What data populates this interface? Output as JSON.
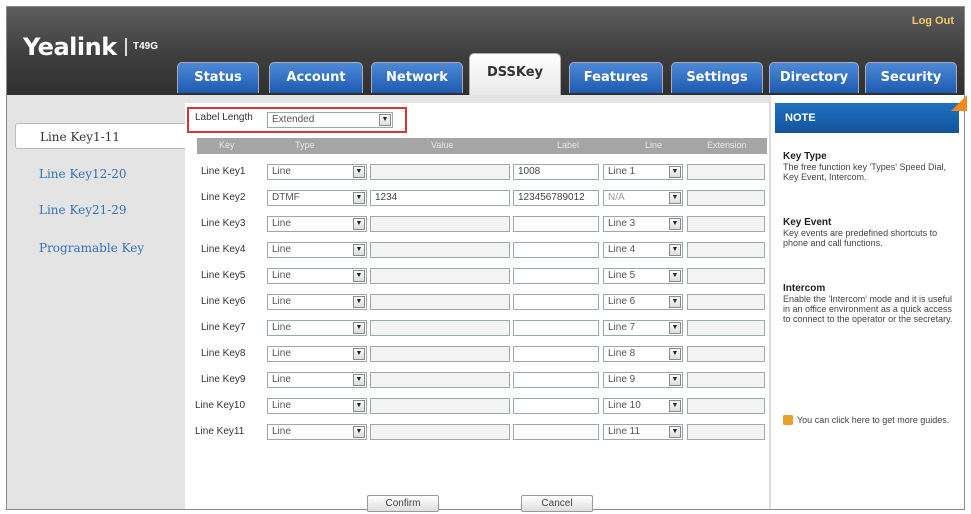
{
  "header": {
    "logo": "Yealink",
    "model": "T49G",
    "logout": "Log Out"
  },
  "tabs": [
    {
      "label": "Status"
    },
    {
      "label": "Account"
    },
    {
      "label": "Network"
    },
    {
      "label": "DSSKey"
    },
    {
      "label": "Features"
    },
    {
      "label": "Settings"
    },
    {
      "label": "Directory"
    },
    {
      "label": "Security"
    }
  ],
  "sidebar": {
    "items": [
      "Line Key1-11",
      "Line Key12-20",
      "Line Key21-29",
      "Programable Key"
    ]
  },
  "label_length": {
    "label": "Label Length",
    "value": "Extended"
  },
  "table": {
    "headers": [
      "Key",
      "Type",
      "Value",
      "Label",
      "Line",
      "Extension"
    ],
    "rows": [
      {
        "key": "Line Key1",
        "type": "Line",
        "value": "",
        "label": "1008",
        "line": "Line 1"
      },
      {
        "key": "Line Key2",
        "type": "DTMF",
        "value": "1234",
        "label": "123456789012",
        "line": "N/A"
      },
      {
        "key": "Line Key3",
        "type": "Line",
        "value": "",
        "label": "",
        "line": "Line 3"
      },
      {
        "key": "Line Key4",
        "type": "Line",
        "value": "",
        "label": "",
        "line": "Line 4"
      },
      {
        "key": "Line Key5",
        "type": "Line",
        "value": "",
        "label": "",
        "line": "Line 5"
      },
      {
        "key": "Line Key6",
        "type": "Line",
        "value": "",
        "label": "",
        "line": "Line 6"
      },
      {
        "key": "Line Key7",
        "type": "Line",
        "value": "",
        "label": "",
        "line": "Line 7"
      },
      {
        "key": "Line Key8",
        "type": "Line",
        "value": "",
        "label": "",
        "line": "Line 8"
      },
      {
        "key": "Line Key9",
        "type": "Line",
        "value": "",
        "label": "",
        "line": "Line 9"
      },
      {
        "key": "Line Key10",
        "type": "Line",
        "value": "",
        "label": "",
        "line": "Line 10"
      },
      {
        "key": "Line Key11",
        "type": "Line",
        "value": "",
        "label": "",
        "line": "Line 11"
      }
    ]
  },
  "buttons": {
    "confirm": "Confirm",
    "cancel": "Cancel"
  },
  "note": {
    "title": "NOTE",
    "sections": [
      {
        "heading": "Key Type",
        "text": "The free function key 'Types' Speed Dial, Key Event, Intercom."
      },
      {
        "heading": "Key Event",
        "text": "Key events are predefined shortcuts to phone and call functions."
      },
      {
        "heading": "Intercom",
        "text": "Enable the 'Intercom' mode and it is useful in an office environment as a quick access to connect to the operator or the secretary."
      }
    ],
    "guide": "You can click here to get more guides."
  },
  "colors": {
    "tab_blue": "#1d5ab1",
    "accent_orange": "#f08a1c",
    "highlight_red": "#d9342f",
    "link_blue": "#3473b5"
  }
}
